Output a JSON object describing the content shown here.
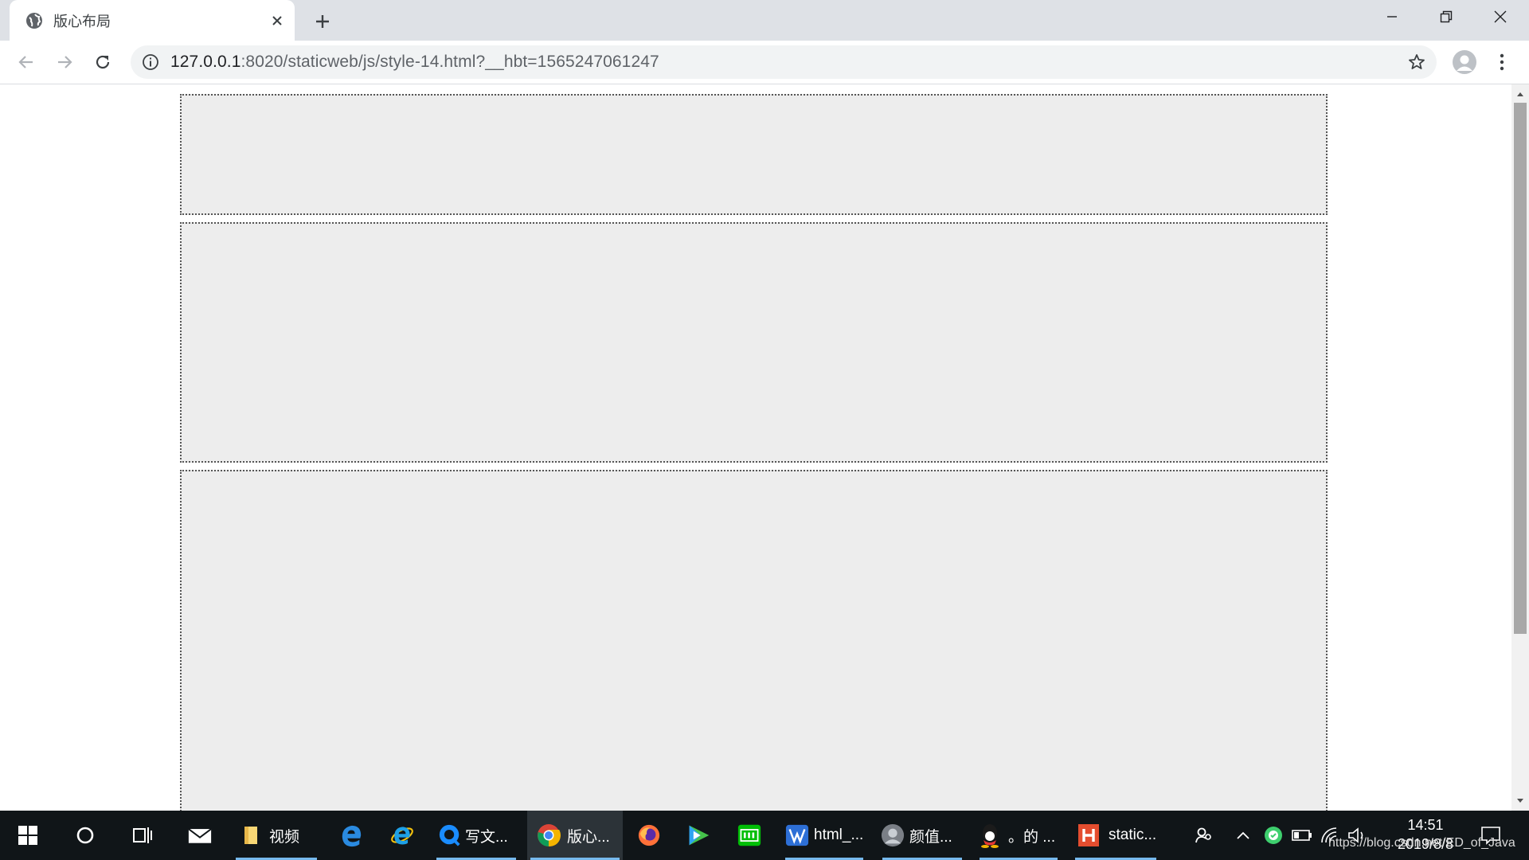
{
  "browser": {
    "tab_title": "版心布局",
    "url_host": "127.0.0.1",
    "url_rest": ":8020/staticweb/js/style-14.html?__hbt=1565247061247",
    "accent": "#1a73e8"
  },
  "page": {
    "box_color": "#ededed",
    "box_border": "#555555",
    "boxes": [
      "header-box",
      "banner-box",
      "content-box"
    ]
  },
  "taskbar": {
    "items": [
      {
        "label": "视频",
        "icon": "folder-icon"
      },
      {
        "label": "写文...",
        "icon": "qq-browser-icon"
      },
      {
        "label": "版心...",
        "icon": "chrome-icon"
      },
      {
        "label": "html_...",
        "icon": "vscode-icon"
      },
      {
        "label": "颜值...",
        "icon": "avatar-app-icon"
      },
      {
        "label": "。的 ...",
        "icon": "qq-icon"
      },
      {
        "label": "static...",
        "icon": "hbuilder-icon"
      }
    ],
    "time": "14:51",
    "date": "2019/8/8",
    "watermark": "https://blog.csdn.net/ED_of_Java"
  }
}
